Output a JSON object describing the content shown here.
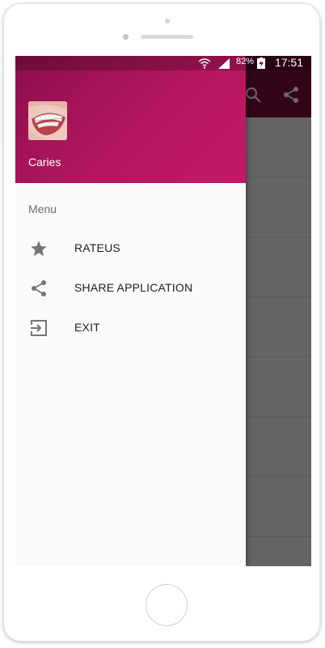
{
  "status_bar": {
    "battery": "82%",
    "time": "17:51"
  },
  "app_bar": {
    "icons": [
      "search-icon",
      "share-icon"
    ]
  },
  "drawer": {
    "header": {
      "title": "Caries",
      "avatar": "teeth-photo"
    },
    "section_label": "Menu",
    "items": [
      {
        "label": "RATEUS",
        "icon": "star-icon"
      },
      {
        "label": "SHARE APPLICATION",
        "icon": "share-icon"
      },
      {
        "label": "EXIT",
        "icon": "exit-icon"
      }
    ]
  },
  "colors": {
    "primary": "#b51760",
    "primary_dark": "#7a0c3e"
  }
}
